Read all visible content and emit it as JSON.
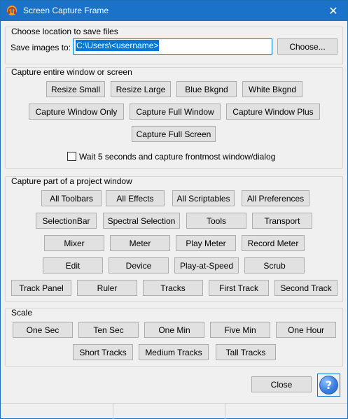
{
  "window": {
    "title": "Screen Capture Frame"
  },
  "save_location": {
    "group_label": "Choose location to save files",
    "field_label": "Save images to:",
    "path_value": "C:\\Users\\<username>",
    "choose_label": "Choose..."
  },
  "entire_window": {
    "group_label": "Capture entire window or screen",
    "buttons": [
      "Resize Small",
      "Resize Large",
      "Blue Bkgnd",
      "White Bkgnd",
      "Capture Window Only",
      "Capture Full Window",
      "Capture Window Plus",
      "Capture Full Screen"
    ],
    "wait_checkbox_label": "Wait 5 seconds and capture frontmost window/dialog",
    "wait_checked": false
  },
  "project_window": {
    "group_label": "Capture part of a project window",
    "buttons": [
      "All Toolbars",
      "All Effects",
      "All Scriptables",
      "All Preferences",
      "SelectionBar",
      "Spectral Selection",
      "Tools",
      "Transport",
      "Mixer",
      "Meter",
      "Play Meter",
      "Record Meter",
      "Edit",
      "Device",
      "Play-at-Speed",
      "Scrub",
      "Track Panel",
      "Ruler",
      "Tracks",
      "First Track",
      "Second Track"
    ]
  },
  "scale": {
    "group_label": "Scale",
    "buttons": [
      "One Sec",
      "Ten Sec",
      "One Min",
      "Five Min",
      "One Hour",
      "Short Tracks",
      "Medium Tracks",
      "Tall Tracks"
    ]
  },
  "footer": {
    "close_label": "Close",
    "help_label": "?"
  },
  "colors": {
    "titlebar": "#1a73c8",
    "selection": "#0078d7"
  }
}
